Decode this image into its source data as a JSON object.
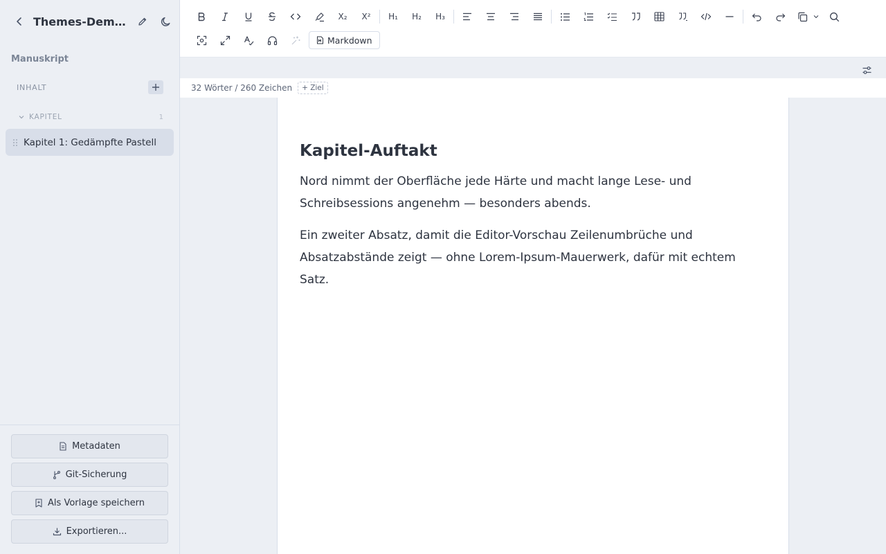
{
  "sidebar": {
    "title": "Themes-Demo: Gedämpfte Pastelltöne",
    "section_title": "Manuskript",
    "contents_label": "INHALT",
    "group_label": "KAPITEL",
    "group_count": "1",
    "chapters": [
      {
        "label": "Kapitel 1: Gedämpfte Pastell"
      }
    ],
    "buttons": {
      "metadata": "Metadaten",
      "git": "Git-Sicherung",
      "template": "Als Vorlage speichern",
      "export": "Exportieren..."
    }
  },
  "toolbar": {
    "markdown_label": "Markdown",
    "subscript_label": "X₂",
    "superscript_label": "X²",
    "h1_label": "H₁",
    "h2_label": "H₂",
    "h3_label": "H₃"
  },
  "status": {
    "count": "32 Wörter / 260 Zeichen",
    "goal_label": "+ Ziel"
  },
  "document": {
    "heading": "Kapitel-Auftakt",
    "paragraphs": [
      "Nord nimmt der Oberfläche jede Härte und macht lange Lese- und Schreibsessions angenehm — besonders abends.",
      "Ein zweiter Absatz, damit die Editor-Vorschau Zeilenumbrüche und Absatzabstände zeigt — ohne Lorem-Ipsum-Mauerwerk, dafür mit echtem Satz."
    ]
  },
  "colors": {
    "background": "#eceff4",
    "surface": "#ffffff",
    "text": "#2e3440",
    "selected": "#d8dee9"
  }
}
